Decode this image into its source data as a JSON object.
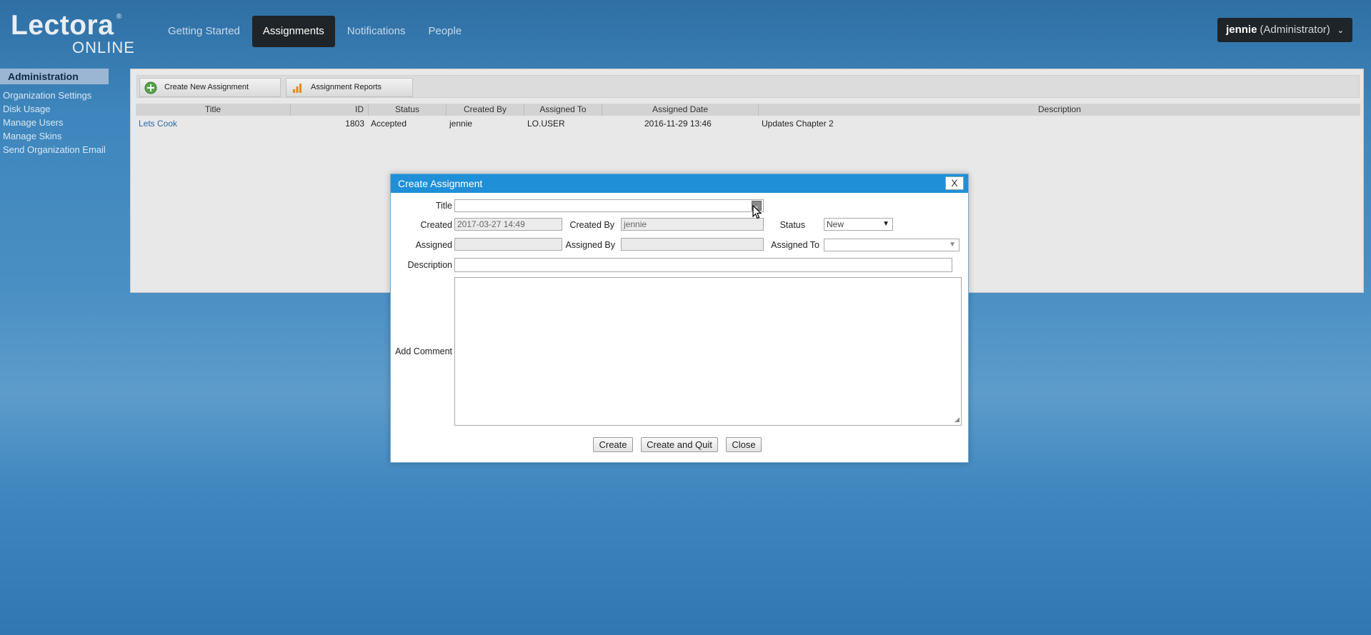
{
  "logo": {
    "line1": "Lectora",
    "line2": "ONLINE",
    "reg": "®"
  },
  "nav": {
    "items": [
      "Getting Started",
      "Assignments",
      "Notifications",
      "People"
    ],
    "active": "Assignments"
  },
  "user": {
    "name": "jennie",
    "role": "(Administrator)"
  },
  "sidebar": {
    "heading": "Administration",
    "items": [
      "Organization Settings",
      "Disk Usage",
      "Manage Users",
      "Manage Skins",
      "Send Organization Email"
    ]
  },
  "toolbar": {
    "create_label": "Create New Assignment",
    "reports_label": "Assignment Reports"
  },
  "table": {
    "headers": [
      "Title",
      "ID",
      "Status",
      "Created By",
      "Assigned To",
      "Assigned Date",
      "Description"
    ],
    "rows": [
      {
        "title": "Lets Cook",
        "id": "1803",
        "status": "Accepted",
        "created_by": "jennie",
        "assigned_to": "LO.USER",
        "assigned_date": "2016-11-29 13:46",
        "description": "Updates Chapter 2"
      }
    ]
  },
  "dialog": {
    "title": "Create Assignment",
    "close": "X",
    "labels": {
      "title": "Title",
      "created": "Created",
      "created_by": "Created By",
      "status": "Status",
      "assigned": "Assigned",
      "assigned_by": "Assigned By",
      "assigned_to": "Assigned To",
      "description": "Description",
      "add_comment": "Add Comment"
    },
    "values": {
      "title": "",
      "created": "2017-03-27 14:49",
      "created_by": "jennie",
      "status": "New",
      "assigned": "",
      "assigned_by": "",
      "assigned_to": "",
      "description": ""
    },
    "buttons": {
      "create": "Create",
      "create_quit": "Create and Quit",
      "close": "Close"
    }
  },
  "colors": {
    "dialog_title_bar": "#1f8fd8",
    "nav_active": "#1f2428",
    "link": "#2a6aa8"
  }
}
